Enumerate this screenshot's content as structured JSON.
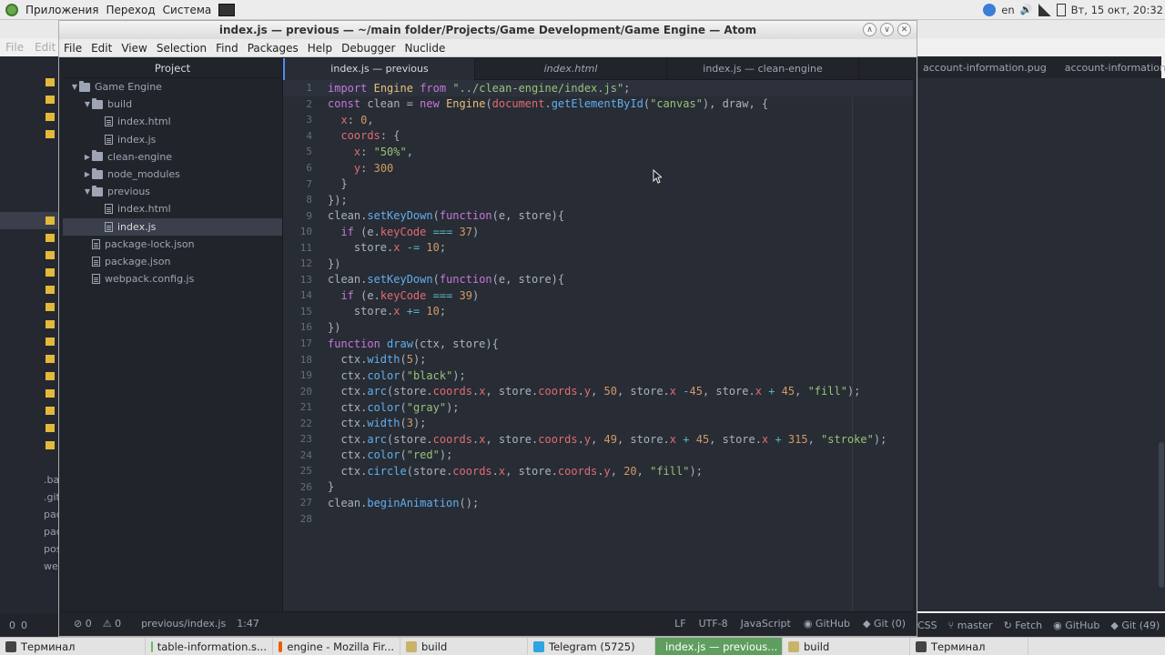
{
  "top_panel": {
    "menu": [
      "Приложения",
      "Переход",
      "Система"
    ],
    "tray": {
      "lang": "en",
      "datetime": "Вт, 15 окт, 20:32"
    }
  },
  "background_window": {
    "menu": [
      "File",
      "Edit"
    ],
    "tabs": [
      "account-information.pug",
      "account-information.js"
    ],
    "sidebar_fragments": [
      ".ba",
      ".git",
      "pac",
      "pac",
      "pos",
      "wel"
    ],
    "status": {
      "left": [
        "0",
        "0"
      ],
      "css": "CSS",
      "branch": "master",
      "fetch": "Fetch",
      "github": "GitHub",
      "git": "Git (49)"
    }
  },
  "window": {
    "title": "index.js — previous — ~/main folder/Projects/Game Development/Game Engine — Atom",
    "menu": [
      "File",
      "Edit",
      "View",
      "Selection",
      "Find",
      "Packages",
      "Help",
      "Debugger",
      "Nuclide"
    ]
  },
  "tree": {
    "header": "Project",
    "items": [
      {
        "label": "Game Engine",
        "type": "folder",
        "open": true,
        "depth": 0
      },
      {
        "label": "build",
        "type": "folder",
        "open": true,
        "depth": 1
      },
      {
        "label": "index.html",
        "type": "file",
        "depth": 2
      },
      {
        "label": "index.js",
        "type": "file",
        "depth": 2
      },
      {
        "label": "clean-engine",
        "type": "folder",
        "open": false,
        "depth": 1
      },
      {
        "label": "node_modules",
        "type": "folder",
        "open": false,
        "depth": 1
      },
      {
        "label": "previous",
        "type": "folder",
        "open": true,
        "depth": 1
      },
      {
        "label": "index.html",
        "type": "file",
        "depth": 2
      },
      {
        "label": "index.js",
        "type": "file",
        "depth": 2,
        "selected": true
      },
      {
        "label": "package-lock.json",
        "type": "file",
        "depth": 1
      },
      {
        "label": "package.json",
        "type": "file",
        "depth": 1
      },
      {
        "label": "webpack.config.js",
        "type": "file",
        "depth": 1
      }
    ]
  },
  "tabs": [
    {
      "label": "index.js — previous",
      "active": true
    },
    {
      "label": "index.html",
      "italic": true
    },
    {
      "label": "index.js — clean-engine"
    }
  ],
  "code_lines": [
    [
      [
        "k",
        "import"
      ],
      [
        "t",
        " "
      ],
      [
        "c",
        "Engine"
      ],
      [
        "t",
        " "
      ],
      [
        "k",
        "from"
      ],
      [
        "t",
        " "
      ],
      [
        "s",
        "\"../clean-engine/index.js\""
      ],
      [
        "t",
        ";"
      ]
    ],
    [
      [
        "k",
        "const"
      ],
      [
        "t",
        " clean = "
      ],
      [
        "k",
        "new"
      ],
      [
        "t",
        " "
      ],
      [
        "c",
        "Engine"
      ],
      [
        "t",
        "("
      ],
      [
        "p",
        "document"
      ],
      [
        "t",
        "."
      ],
      [
        "f",
        "getElementById"
      ],
      [
        "t",
        "("
      ],
      [
        "s",
        "\"canvas\""
      ],
      [
        "t",
        "), draw, {"
      ]
    ],
    [
      [
        "t",
        "  "
      ],
      [
        "p",
        "x"
      ],
      [
        "t",
        ": "
      ],
      [
        "n",
        "0"
      ],
      [
        "t",
        ","
      ]
    ],
    [
      [
        "t",
        "  "
      ],
      [
        "p",
        "coords"
      ],
      [
        "t",
        ": {"
      ]
    ],
    [
      [
        "t",
        "    "
      ],
      [
        "p",
        "x"
      ],
      [
        "t",
        ": "
      ],
      [
        "s",
        "\"50%\""
      ],
      [
        "t",
        ","
      ]
    ],
    [
      [
        "t",
        "    "
      ],
      [
        "p",
        "y"
      ],
      [
        "t",
        ": "
      ],
      [
        "n",
        "300"
      ]
    ],
    [
      [
        "t",
        "  }"
      ]
    ],
    [
      [
        "t",
        "});"
      ]
    ],
    [
      [
        "t",
        "clean."
      ],
      [
        "f",
        "setKeyDown"
      ],
      [
        "t",
        "("
      ],
      [
        "k",
        "function"
      ],
      [
        "t",
        "(e, store){"
      ]
    ],
    [
      [
        "t",
        "  "
      ],
      [
        "k",
        "if"
      ],
      [
        "t",
        " (e."
      ],
      [
        "p",
        "keyCode"
      ],
      [
        "t",
        " "
      ],
      [
        "o",
        "==="
      ],
      [
        "t",
        " "
      ],
      [
        "n",
        "37"
      ],
      [
        "t",
        ")"
      ]
    ],
    [
      [
        "t",
        "    store."
      ],
      [
        "p",
        "x"
      ],
      [
        "t",
        " "
      ],
      [
        "o",
        "-="
      ],
      [
        "t",
        " "
      ],
      [
        "n",
        "10"
      ],
      [
        "t",
        ";"
      ]
    ],
    [
      [
        "t",
        "})"
      ]
    ],
    [
      [
        "t",
        "clean."
      ],
      [
        "f",
        "setKeyDown"
      ],
      [
        "t",
        "("
      ],
      [
        "k",
        "function"
      ],
      [
        "t",
        "(e, store){"
      ]
    ],
    [
      [
        "t",
        "  "
      ],
      [
        "k",
        "if"
      ],
      [
        "t",
        " (e."
      ],
      [
        "p",
        "keyCode"
      ],
      [
        "t",
        " "
      ],
      [
        "o",
        "==="
      ],
      [
        "t",
        " "
      ],
      [
        "n",
        "39"
      ],
      [
        "t",
        ")"
      ]
    ],
    [
      [
        "t",
        "    store."
      ],
      [
        "p",
        "x"
      ],
      [
        "t",
        " "
      ],
      [
        "o",
        "+="
      ],
      [
        "t",
        " "
      ],
      [
        "n",
        "10"
      ],
      [
        "t",
        ";"
      ]
    ],
    [
      [
        "t",
        "})"
      ]
    ],
    [
      [
        "k",
        "function"
      ],
      [
        "t",
        " "
      ],
      [
        "f",
        "draw"
      ],
      [
        "t",
        "(ctx, store){"
      ]
    ],
    [
      [
        "t",
        "  ctx."
      ],
      [
        "f",
        "width"
      ],
      [
        "t",
        "("
      ],
      [
        "n",
        "5"
      ],
      [
        "t",
        ");"
      ]
    ],
    [
      [
        "t",
        "  ctx."
      ],
      [
        "f",
        "color"
      ],
      [
        "t",
        "("
      ],
      [
        "s",
        "\"black\""
      ],
      [
        "t",
        ");"
      ]
    ],
    [
      [
        "t",
        "  ctx."
      ],
      [
        "f",
        "arc"
      ],
      [
        "t",
        "(store."
      ],
      [
        "p",
        "coords"
      ],
      [
        "t",
        "."
      ],
      [
        "p",
        "x"
      ],
      [
        "t",
        ", store."
      ],
      [
        "p",
        "coords"
      ],
      [
        "t",
        "."
      ],
      [
        "p",
        "y"
      ],
      [
        "t",
        ", "
      ],
      [
        "n",
        "50"
      ],
      [
        "t",
        ", store."
      ],
      [
        "p",
        "x"
      ],
      [
        "t",
        " "
      ],
      [
        "o",
        "-"
      ],
      [
        "n",
        "45"
      ],
      [
        "t",
        ", store."
      ],
      [
        "p",
        "x"
      ],
      [
        "t",
        " "
      ],
      [
        "o",
        "+"
      ],
      [
        "t",
        " "
      ],
      [
        "n",
        "45"
      ],
      [
        "t",
        ", "
      ],
      [
        "s",
        "\"fill\""
      ],
      [
        "t",
        ");"
      ]
    ],
    [
      [
        "t",
        "  ctx."
      ],
      [
        "f",
        "color"
      ],
      [
        "t",
        "("
      ],
      [
        "s",
        "\"gray\""
      ],
      [
        "t",
        ");"
      ]
    ],
    [
      [
        "t",
        "  ctx."
      ],
      [
        "f",
        "width"
      ],
      [
        "t",
        "("
      ],
      [
        "n",
        "3"
      ],
      [
        "t",
        ");"
      ]
    ],
    [
      [
        "t",
        "  ctx."
      ],
      [
        "f",
        "arc"
      ],
      [
        "t",
        "(store."
      ],
      [
        "p",
        "coords"
      ],
      [
        "t",
        "."
      ],
      [
        "p",
        "x"
      ],
      [
        "t",
        ", store."
      ],
      [
        "p",
        "coords"
      ],
      [
        "t",
        "."
      ],
      [
        "p",
        "y"
      ],
      [
        "t",
        ", "
      ],
      [
        "n",
        "49"
      ],
      [
        "t",
        ", store."
      ],
      [
        "p",
        "x"
      ],
      [
        "t",
        " "
      ],
      [
        "o",
        "+"
      ],
      [
        "t",
        " "
      ],
      [
        "n",
        "45"
      ],
      [
        "t",
        ", store."
      ],
      [
        "p",
        "x"
      ],
      [
        "t",
        " "
      ],
      [
        "o",
        "+"
      ],
      [
        "t",
        " "
      ],
      [
        "n",
        "315"
      ],
      [
        "t",
        ", "
      ],
      [
        "s",
        "\"stroke\""
      ],
      [
        "t",
        ");"
      ]
    ],
    [
      [
        "t",
        "  ctx."
      ],
      [
        "f",
        "color"
      ],
      [
        "t",
        "("
      ],
      [
        "s",
        "\"red\""
      ],
      [
        "t",
        ");"
      ]
    ],
    [
      [
        "t",
        "  ctx."
      ],
      [
        "f",
        "circle"
      ],
      [
        "t",
        "(store."
      ],
      [
        "p",
        "coords"
      ],
      [
        "t",
        "."
      ],
      [
        "p",
        "x"
      ],
      [
        "t",
        ", store."
      ],
      [
        "p",
        "coords"
      ],
      [
        "t",
        "."
      ],
      [
        "p",
        "y"
      ],
      [
        "t",
        ", "
      ],
      [
        "n",
        "20"
      ],
      [
        "t",
        ", "
      ],
      [
        "s",
        "\"fill\""
      ],
      [
        "t",
        ");"
      ]
    ],
    [
      [
        "t",
        "}"
      ]
    ],
    [
      [
        "t",
        "clean."
      ],
      [
        "f",
        "beginAnimation"
      ],
      [
        "t",
        "();"
      ]
    ],
    [
      [
        "t",
        ""
      ]
    ]
  ],
  "status": {
    "errors": "0",
    "warnings": "0",
    "path": "previous/index.js",
    "cursor": "1:47",
    "eol": "LF",
    "encoding": "UTF-8",
    "grammar": "JavaScript",
    "github": "GitHub",
    "git": "Git (0)"
  },
  "taskbar": [
    {
      "label": "Терминал",
      "icon": "terminal-icon",
      "color": "#444444"
    },
    {
      "label": "table-information.s...",
      "icon": "atom-icon",
      "color": "#66bb66"
    },
    {
      "label": "engine - Mozilla Fir...",
      "icon": "firefox-icon",
      "color": "#e66000"
    },
    {
      "label": "build",
      "icon": "folder-icon",
      "color": "#c9b36b"
    },
    {
      "label": "Telegram (5725)",
      "icon": "telegram-icon",
      "color": "#2ca5e0"
    },
    {
      "label": "index.js — previous...",
      "icon": "atom-icon",
      "color": "#66bb66",
      "active": true
    },
    {
      "label": "build",
      "icon": "folder-icon",
      "color": "#c9b36b"
    },
    {
      "label": "Терминал",
      "icon": "terminal-icon",
      "color": "#444444"
    }
  ]
}
